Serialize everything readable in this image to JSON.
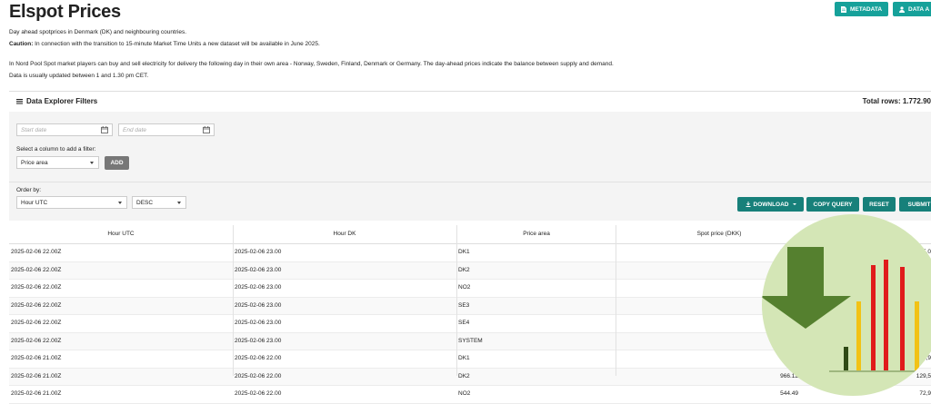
{
  "page": {
    "title": "Elspot Prices",
    "intro": "Day ahead spotprices in Denmark (DK) and neighbouring countries.",
    "caution_label": "Caution:",
    "caution_text": " In connection with the transition to 15-minute Market Time Units a new dataset will be available in June 2025.",
    "description": "In Nord Pool Spot market players can buy and sell electricity for delivery the following day in their own area - Norway, Sweden, Finland, Denmark or Germany. The day-ahead prices indicate the balance between supply and demand.",
    "update_note": "Data is usually updated between 1 and 1.30 pm CET."
  },
  "top_buttons": {
    "metadata": "METADATA",
    "data_api": "DATA A"
  },
  "filters": {
    "title": "Data Explorer Filters",
    "total_rows": "Total rows: 1.772.90",
    "start_placeholder": "Start date",
    "end_placeholder": "End date",
    "column_label": "Select a column to add a filter:",
    "column_value": "Price area",
    "add_label": "ADD",
    "order_label": "Order by:",
    "order_value": "Hour UTC",
    "direction_value": "DESC"
  },
  "actions": {
    "download": "DOWNLOAD",
    "copy_query": "COPY QUERY",
    "reset": "RESET",
    "submit": "SUBMIT"
  },
  "table": {
    "headers": [
      "Hour UTC",
      "Hour DK",
      "Price area",
      "Spot price (DKK)"
    ],
    "rows": [
      [
        "2025-02-06 22.00Z",
        "2025-02-06 23.00",
        "DK1",
        "858.10",
        "115,0"
      ],
      [
        "2025-02-06 22.00Z",
        "2025-02-06 23.00",
        "DK2",
        "886.15",
        "7"
      ],
      [
        "2025-02-06 22.00Z",
        "2025-02-06 23.00",
        "NO2",
        "464.97",
        ""
      ],
      [
        "2025-02-06 22.00Z",
        "2025-02-06 23.00",
        "SE3",
        "253.49",
        ""
      ],
      [
        "2025-02-06 22.00Z",
        "2025-02-06 23.00",
        "SE4",
        "491.60",
        ""
      ],
      [
        "2025-02-06 22.00Z",
        "2025-02-06 23.00",
        "SYSTEM",
        "322.79",
        "2"
      ],
      [
        "2025-02-06 21.00Z",
        "2025-02-06 22.00",
        "DK1",
        "909.58",
        "21,9"
      ],
      [
        "2025-02-06 21.00Z",
        "2025-02-06 22.00",
        "DK2",
        "966.12",
        "129,5"
      ],
      [
        "2025-02-06 21.00Z",
        "2025-02-06 22.00",
        "NO2",
        "544.49",
        "72,9"
      ]
    ]
  },
  "colors": {
    "teal": "#16a19a",
    "dark_teal": "#17807a",
    "overlay_bg": "#d4e6b6",
    "arrow_green": "#55802f",
    "bar_red": "#e01b1b",
    "bar_yellow": "#f2c215"
  }
}
